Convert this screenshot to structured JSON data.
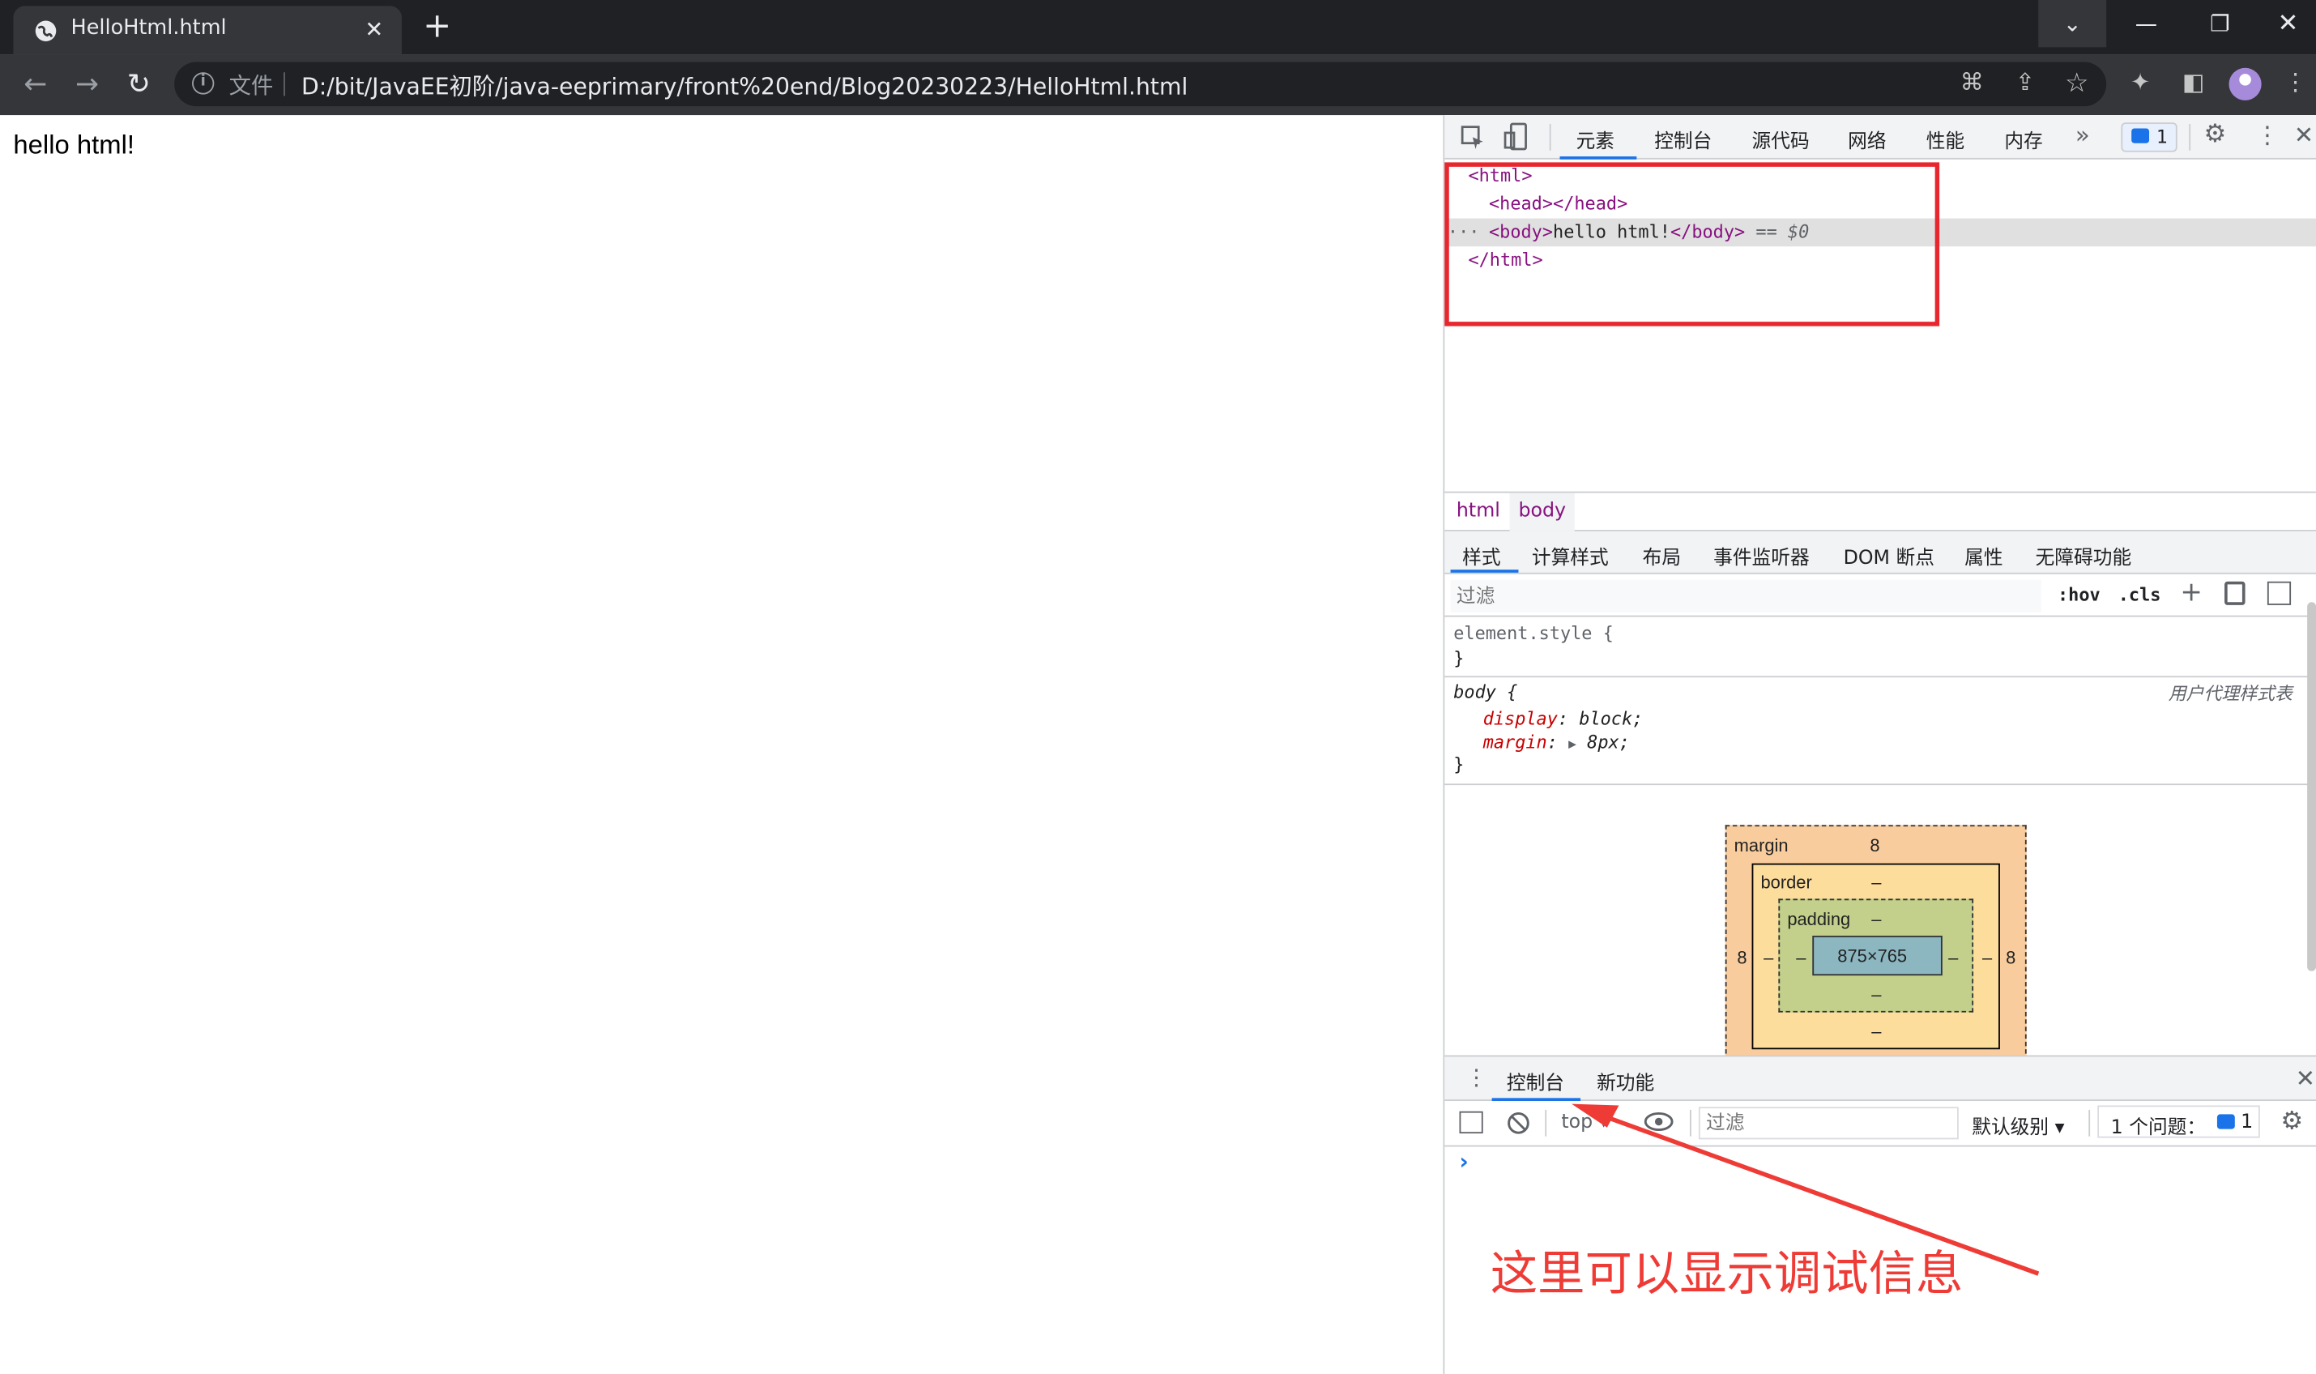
{
  "browser": {
    "tab_title": "HelloHtml.html",
    "new_tab_symbol": "+",
    "address_label": "文件",
    "url": "D:/bit/JavaEE初阶/java-eeprimary/front%20end/Blog20230223/HelloHtml.html"
  },
  "page": {
    "text": "hello html!"
  },
  "devtools": {
    "tabs": [
      "元素",
      "控制台",
      "源代码",
      "网络",
      "性能",
      "内存"
    ],
    "issues_badge": "1",
    "dom": {
      "html_open": "<html>",
      "head": "<head></head>",
      "body_open": "<body>",
      "body_text": "hello html!",
      "body_close": "</body>",
      "selected_marker": "== $0",
      "html_close": "</html>",
      "ellipsis": "···"
    },
    "breadcrumb": [
      "html",
      "body"
    ],
    "sub_tabs": [
      "样式",
      "计算样式",
      "布局",
      "事件监听器",
      "DOM 断点",
      "属性",
      "无障碍功能"
    ],
    "filter_placeholder": "过滤",
    "hov": ":hov",
    "cls": ".cls",
    "styles": {
      "element_style_selector": "element.style {",
      "close_brace": "}",
      "body_selector": "body {",
      "user_agent": "用户代理样式表",
      "rules": [
        {
          "prop": "display",
          "value": "block;"
        },
        {
          "prop": "margin",
          "value": "8px;"
        }
      ]
    },
    "box_model": {
      "margin_label": "margin",
      "margin_top": "8",
      "margin_left": "8",
      "margin_right": "8",
      "border_label": "border",
      "border_val": "–",
      "padding_label": "padding",
      "padding_val": "–",
      "content": "875×765",
      "dash": "–"
    },
    "drawer": {
      "tabs": [
        "控制台",
        "新功能"
      ],
      "context": "top",
      "filter_placeholder": "过滤",
      "level": "默认级别",
      "issues_label": "1 个问题：",
      "issues_count": "1",
      "prompt": "›"
    }
  },
  "annotation": "这里可以显示调试信息",
  "colors": {
    "annotation": "#ef3b36",
    "redbox": "#e8262e",
    "accent": "#1a73e8"
  }
}
